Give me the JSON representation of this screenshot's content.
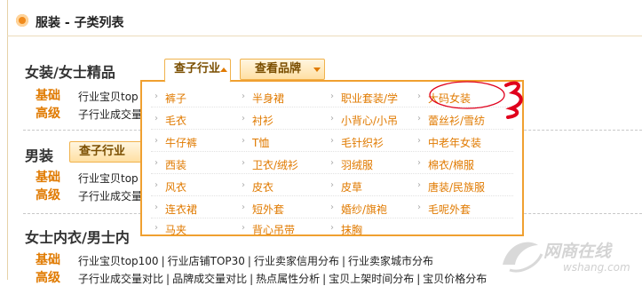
{
  "header": {
    "title": "服装 - 子类列表"
  },
  "sections": [
    {
      "title": "女装/女士精品",
      "btn_industry": "查子行业",
      "btn_brand": "查看品牌",
      "row1_label": "基础",
      "row1_text": "行业宝贝top",
      "row2_label": "高级",
      "row2_text": "子行业成交量"
    },
    {
      "title": "男装",
      "btn_industry": "查子行业",
      "row1_label": "基础",
      "row1_text": "行业宝贝top",
      "row2_label": "高级",
      "row2_text": "子行业成交量"
    },
    {
      "title": "女士内衣/男士内",
      "row1_label": "基础",
      "row1_links": [
        "行业宝贝top100",
        "行业店铺TOP30",
        "行业卖家信用分布",
        "行业卖家城市分布"
      ],
      "row2_label": "高级",
      "row2_links": [
        "子行业成交量对比",
        "品牌成交量对比",
        "热点属性分析",
        "宝贝上架时间分布",
        "宝贝价格分布"
      ]
    }
  ],
  "dropdown": {
    "items": [
      [
        "裤子",
        "半身裙",
        "职业套装/学",
        "大码女装"
      ],
      [
        "毛衣",
        "衬衫",
        "小背心/小吊",
        "蕾丝衫/雪纺"
      ],
      [
        "牛仔裤",
        "T恤",
        "毛针织衫",
        "中老年女装"
      ],
      [
        "西装",
        "卫衣/绒衫",
        "羽绒服",
        "棉衣/棉服"
      ],
      [
        "风衣",
        "皮衣",
        "皮草",
        "唐装/民族服"
      ],
      [
        "连衣裙",
        "短外套",
        "婚纱/旗袍",
        "毛呢外套"
      ],
      [
        "马夹",
        "背心吊带",
        "抹胸"
      ]
    ],
    "highlighted": "大码女装",
    "highlight_color": "#e0001c"
  },
  "watermark": {
    "text_cn": "网商在线",
    "text_en": "wshang.com"
  },
  "colors": {
    "accent": "#e07a00",
    "border": "#f0a030"
  }
}
